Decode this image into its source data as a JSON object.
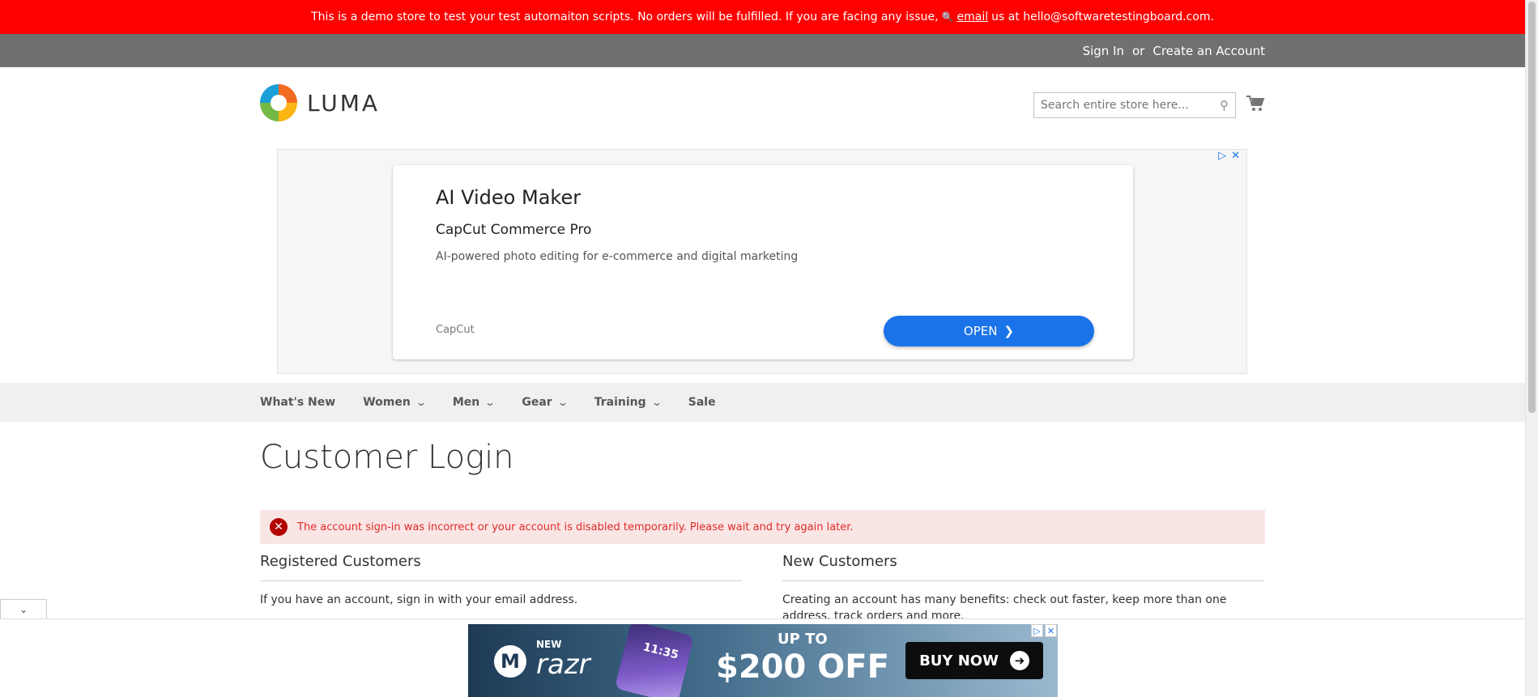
{
  "demo_notice": {
    "text_before": "This is a demo store to test your test automaiton scripts. No orders will be fulfilled. If you are facing any issue,",
    "link": "email",
    "text_after": "us at hello@softwaretestingboard.com."
  },
  "header_links": {
    "sign_in": "Sign In",
    "or": "or",
    "create_account": "Create an Account"
  },
  "logo": {
    "text": "LUMA"
  },
  "search": {
    "placeholder": "Search entire store here..."
  },
  "top_ad": {
    "headline": "AI Video Maker",
    "subheadline": "CapCut Commerce Pro",
    "description": "AI-powered photo editing for e-commerce and digital marketing",
    "advertiser": "CapCut",
    "cta": "OPEN"
  },
  "nav": {
    "items": [
      {
        "label": "What's New",
        "has_dropdown": false
      },
      {
        "label": "Women",
        "has_dropdown": true
      },
      {
        "label": "Men",
        "has_dropdown": true
      },
      {
        "label": "Gear",
        "has_dropdown": true
      },
      {
        "label": "Training",
        "has_dropdown": true
      },
      {
        "label": "Sale",
        "has_dropdown": false
      }
    ]
  },
  "page_title": "Customer Login",
  "error_message": "The account sign-in was incorrect or your account is disabled temporarily. Please wait and try again later.",
  "registered": {
    "title": "Registered Customers",
    "text": "If you have an account, sign in with your email address."
  },
  "new_customers": {
    "title": "New Customers",
    "text": "Creating an account has many benefits: check out faster, keep more than one address, track orders and more."
  },
  "bottom_ad": {
    "new": "NEW",
    "product": "razr",
    "phone_time": "11:35",
    "upto": "UP TO",
    "offer": "$200 OFF",
    "cta": "BUY NOW"
  },
  "colors": {
    "demo_bar": "#ff0000",
    "panel": "#6e716e",
    "error_bg": "#fae5e5",
    "error_text": "#e02b27",
    "ad_button": "#1a73e8"
  }
}
